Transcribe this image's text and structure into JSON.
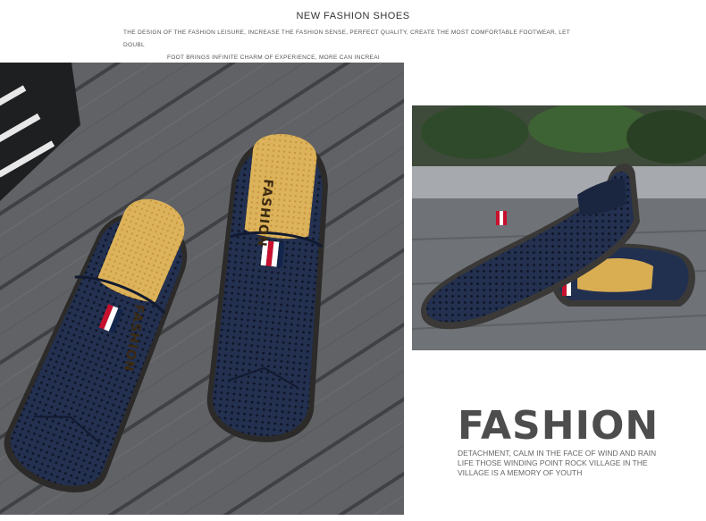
{
  "header": {
    "title": "NEW FASHION SHOES",
    "description_line1": "THE DESIGN OF THE FASHION LEISURE, INCREASE THE FASHION SENSE, PERFECT QUALITY, CREATE THE MOST COMFORTABLE FOOTWEAR, LET DOUBL",
    "description_line2": "FOOT BRINGS INFINITE CHARM OF EXPERIENCE, MORE CAN INCREAI"
  },
  "shoes": {
    "insole_text": "FASHION",
    "colors": {
      "leather": "#1f2b45",
      "insole": "#d9ad52",
      "sole": "#3b3a38",
      "stripe_red": "#c8102e",
      "stripe_white": "#ffffff"
    }
  },
  "feature": {
    "heading": "FASHION",
    "text_line1": "DETACHMENT, CALM IN THE FACE OF WIND AND RAIN",
    "text_line2": "LIFE THOSE WINDING POINT ROCK VILLAGE IN THE",
    "text_line3": "VILLAGE IS A MEMORY OF YOUTH"
  }
}
